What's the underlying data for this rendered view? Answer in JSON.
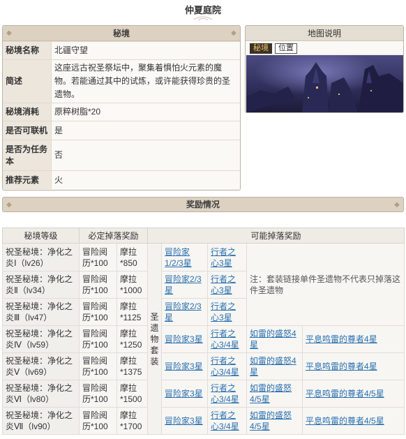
{
  "page": {
    "title": "仲夏庭院"
  },
  "domain_panel": {
    "header": "秘境",
    "rows": [
      {
        "label": "秘境名称",
        "value": "北疆守望"
      },
      {
        "label": "简述",
        "value": "这座远古祝圣祭坛中，聚集着惧怕火元素的魔物。若能通过其中的试炼，或许能获得珍贵的圣遗物。"
      },
      {
        "label": "秘境消耗",
        "value": "原粹树脂*20"
      },
      {
        "label": "是否可联机",
        "value": "是"
      },
      {
        "label": "是否为任务本",
        "value": "否"
      },
      {
        "label": "推荐元素",
        "value": "火"
      }
    ]
  },
  "map_panel": {
    "header": "地图说明",
    "tabs": [
      "秘境",
      "位置"
    ],
    "active_tab": "秘境"
  },
  "rewards": {
    "section_title": "奖励情况",
    "headers": {
      "level": "秘境等级",
      "guaranteed": "必定掉落奖励",
      "possible": "可能掉落奖励"
    },
    "set_label": "圣遗物套装",
    "note": "注：套装链接单件圣遗物不代表只掉落这件圣遗物",
    "rows": [
      {
        "level": "祝圣秘境：净化之炎Ⅰ（lv26）",
        "exp": "冒险阅历*100",
        "mora": "摩拉*850",
        "links": [
          "冒险家1/2/3星",
          "行者之心3星"
        ]
      },
      {
        "level": "祝圣秘境：净化之炎Ⅱ（lv34）",
        "exp": "冒险阅历*100",
        "mora": "摩拉*1000",
        "links": [
          "冒险家2/3星",
          "行者之心3星"
        ]
      },
      {
        "level": "祝圣秘境：净化之炎Ⅲ（lv47）",
        "exp": "冒险阅历*100",
        "mora": "摩拉*1125",
        "links": [
          "冒险家2/3星",
          "行者之心3星"
        ]
      },
      {
        "level": "祝圣秘境：净化之炎Ⅳ（lv59）",
        "exp": "冒险阅历*100",
        "mora": "摩拉*1250",
        "links": [
          "冒险家3星",
          "行者之心3/4星",
          "如雷的盛怒4星",
          "平息鸣雷的尊者4星"
        ]
      },
      {
        "level": "祝圣秘境：净化之炎Ⅴ（lv69）",
        "exp": "冒险阅历*100",
        "mora": "摩拉*1375",
        "links": [
          "冒险家3星",
          "行者之心3/4星",
          "如雷的盛怒4星",
          "平息鸣雷的尊者4星"
        ]
      },
      {
        "level": "祝圣秘境：净化之炎Ⅵ（lv80）",
        "exp": "冒险阅历*100",
        "mora": "摩拉*1500",
        "links": [
          "冒险家3星",
          "行者之心3/4星",
          "如雷的盛怒4/5星",
          "平息鸣雷的尊者4/5星"
        ]
      },
      {
        "level": "祝圣秘境：净化之炎Ⅶ（lv90）",
        "exp": "冒险阅历*100",
        "mora": "摩拉*1700",
        "links": [
          "冒险家3星",
          "行者之心3/4星",
          "如雷的盛怒4/5星",
          "平息鸣雷的尊者4/5星"
        ]
      }
    ]
  },
  "colors": {
    "panel_header": "#ddd2c2",
    "panel_bg": "#f6f2ec",
    "link": "#2a6fb0",
    "active_tab_bg": "#3a3228",
    "active_tab_text": "#f0c060"
  }
}
